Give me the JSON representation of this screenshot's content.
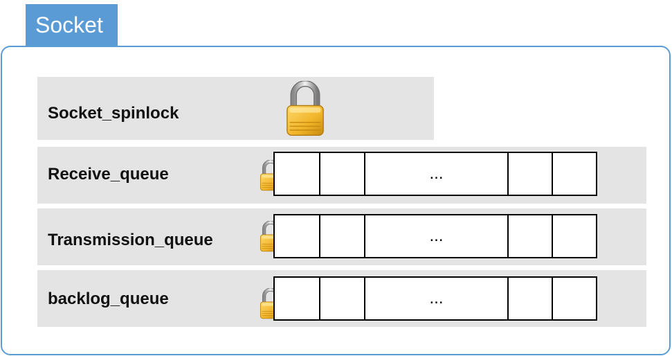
{
  "tab": {
    "title": "Socket"
  },
  "rows": [
    {
      "label": "Socket_spinlock",
      "icon": "padlock-icon"
    },
    {
      "label": "Receive_queue",
      "icon": "padlock-icon",
      "cells": [
        "",
        "",
        "...",
        "",
        ""
      ]
    },
    {
      "label": "Transmission_queue",
      "icon": "padlock-icon",
      "cells": [
        "",
        "",
        "...",
        "",
        ""
      ]
    },
    {
      "label": "backlog_queue",
      "icon": "padlock-icon",
      "cells": [
        "",
        "",
        "...",
        "",
        ""
      ]
    }
  ],
  "colors": {
    "accent": "#5b9bd5",
    "row_bg": "#e4e4e4",
    "lock_gold": "#f0b429"
  }
}
